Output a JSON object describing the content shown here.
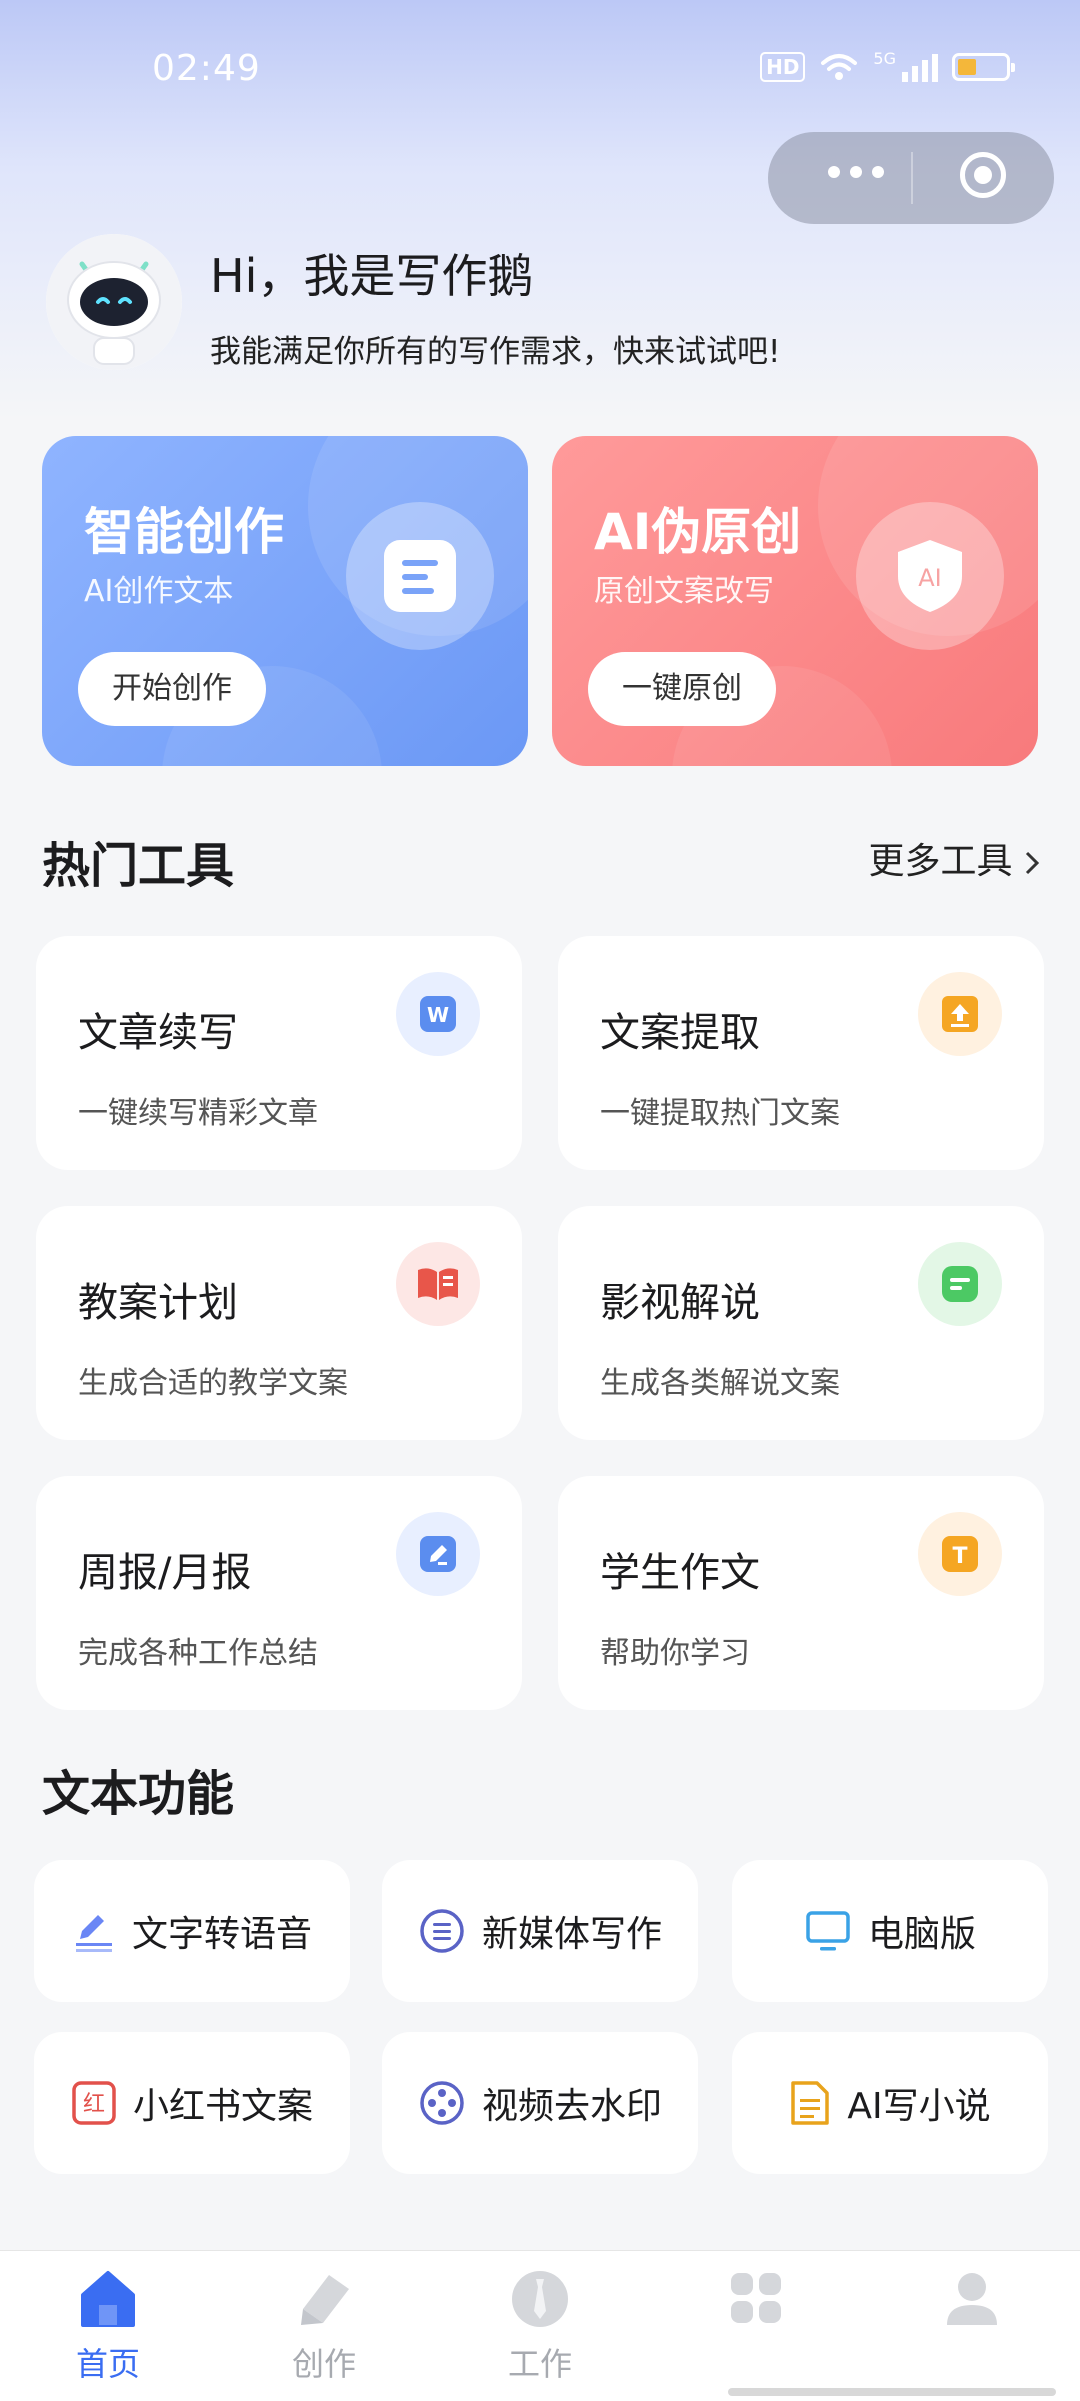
{
  "status_bar": {
    "time": "02:49",
    "hd_label": "HD",
    "network": "5G"
  },
  "greeting": {
    "title": "Hi，我是写作鹅",
    "subtitle": "我能满足你所有的写作需求，快来试试吧!"
  },
  "hero_cards": [
    {
      "title": "智能创作",
      "subtitle": "AI创作文本",
      "button": "开始创作",
      "icon": "document-icon"
    },
    {
      "title": "AI伪原创",
      "subtitle": "原创文案改写",
      "button": "一键原创",
      "icon": "shield-ai-icon",
      "badge": "AI"
    }
  ],
  "hot_tools": {
    "title": "热门工具",
    "more_label": "更多工具",
    "items": [
      {
        "name": "文章续写",
        "desc": "一键续写精彩文章",
        "icon": "word-doc-icon",
        "color": "#5b8def"
      },
      {
        "name": "文案提取",
        "desc": "一键提取热门文案",
        "icon": "upload-icon",
        "color": "#f5a623"
      },
      {
        "name": "教案计划",
        "desc": "生成合适的教学文案",
        "icon": "book-icon",
        "color": "#e8564a"
      },
      {
        "name": "影视解说",
        "desc": "生成各类解说文案",
        "icon": "message-icon",
        "color": "#4cc964"
      },
      {
        "name": "周报/月报",
        "desc": "完成各种工作总结",
        "icon": "edit-icon",
        "color": "#5b8def"
      },
      {
        "name": "学生作文",
        "desc": "帮助你学习",
        "icon": "text-t-icon",
        "color": "#f5a623",
        "glyph": "T"
      }
    ],
    "word_glyph": "W"
  },
  "text_functions": {
    "title": "文本功能",
    "items": [
      {
        "label": "文字转语音",
        "icon": "pen-underline-icon"
      },
      {
        "label": "新媒体写作",
        "icon": "list-circle-icon"
      },
      {
        "label": "电脑版",
        "icon": "monitor-icon"
      },
      {
        "label": "小红书文案",
        "icon": "red-square-icon",
        "glyph": "红"
      },
      {
        "label": "视频去水印",
        "icon": "film-reel-icon"
      },
      {
        "label": "AI写小说",
        "icon": "document-lines-icon"
      }
    ]
  },
  "tab_bar": {
    "tabs": [
      {
        "label": "首页",
        "icon": "home-icon",
        "active": true
      },
      {
        "label": "创作",
        "icon": "tag-icon",
        "active": false
      },
      {
        "label": "工作",
        "icon": "tie-icon",
        "active": false
      },
      {
        "label": "",
        "icon": "grid-icon",
        "active": false
      },
      {
        "label": "",
        "icon": "user-icon",
        "active": false
      }
    ]
  },
  "colors": {
    "accent": "#3a6df2",
    "hero_blue": "#6b98f5",
    "hero_red": "#f87a7c"
  }
}
